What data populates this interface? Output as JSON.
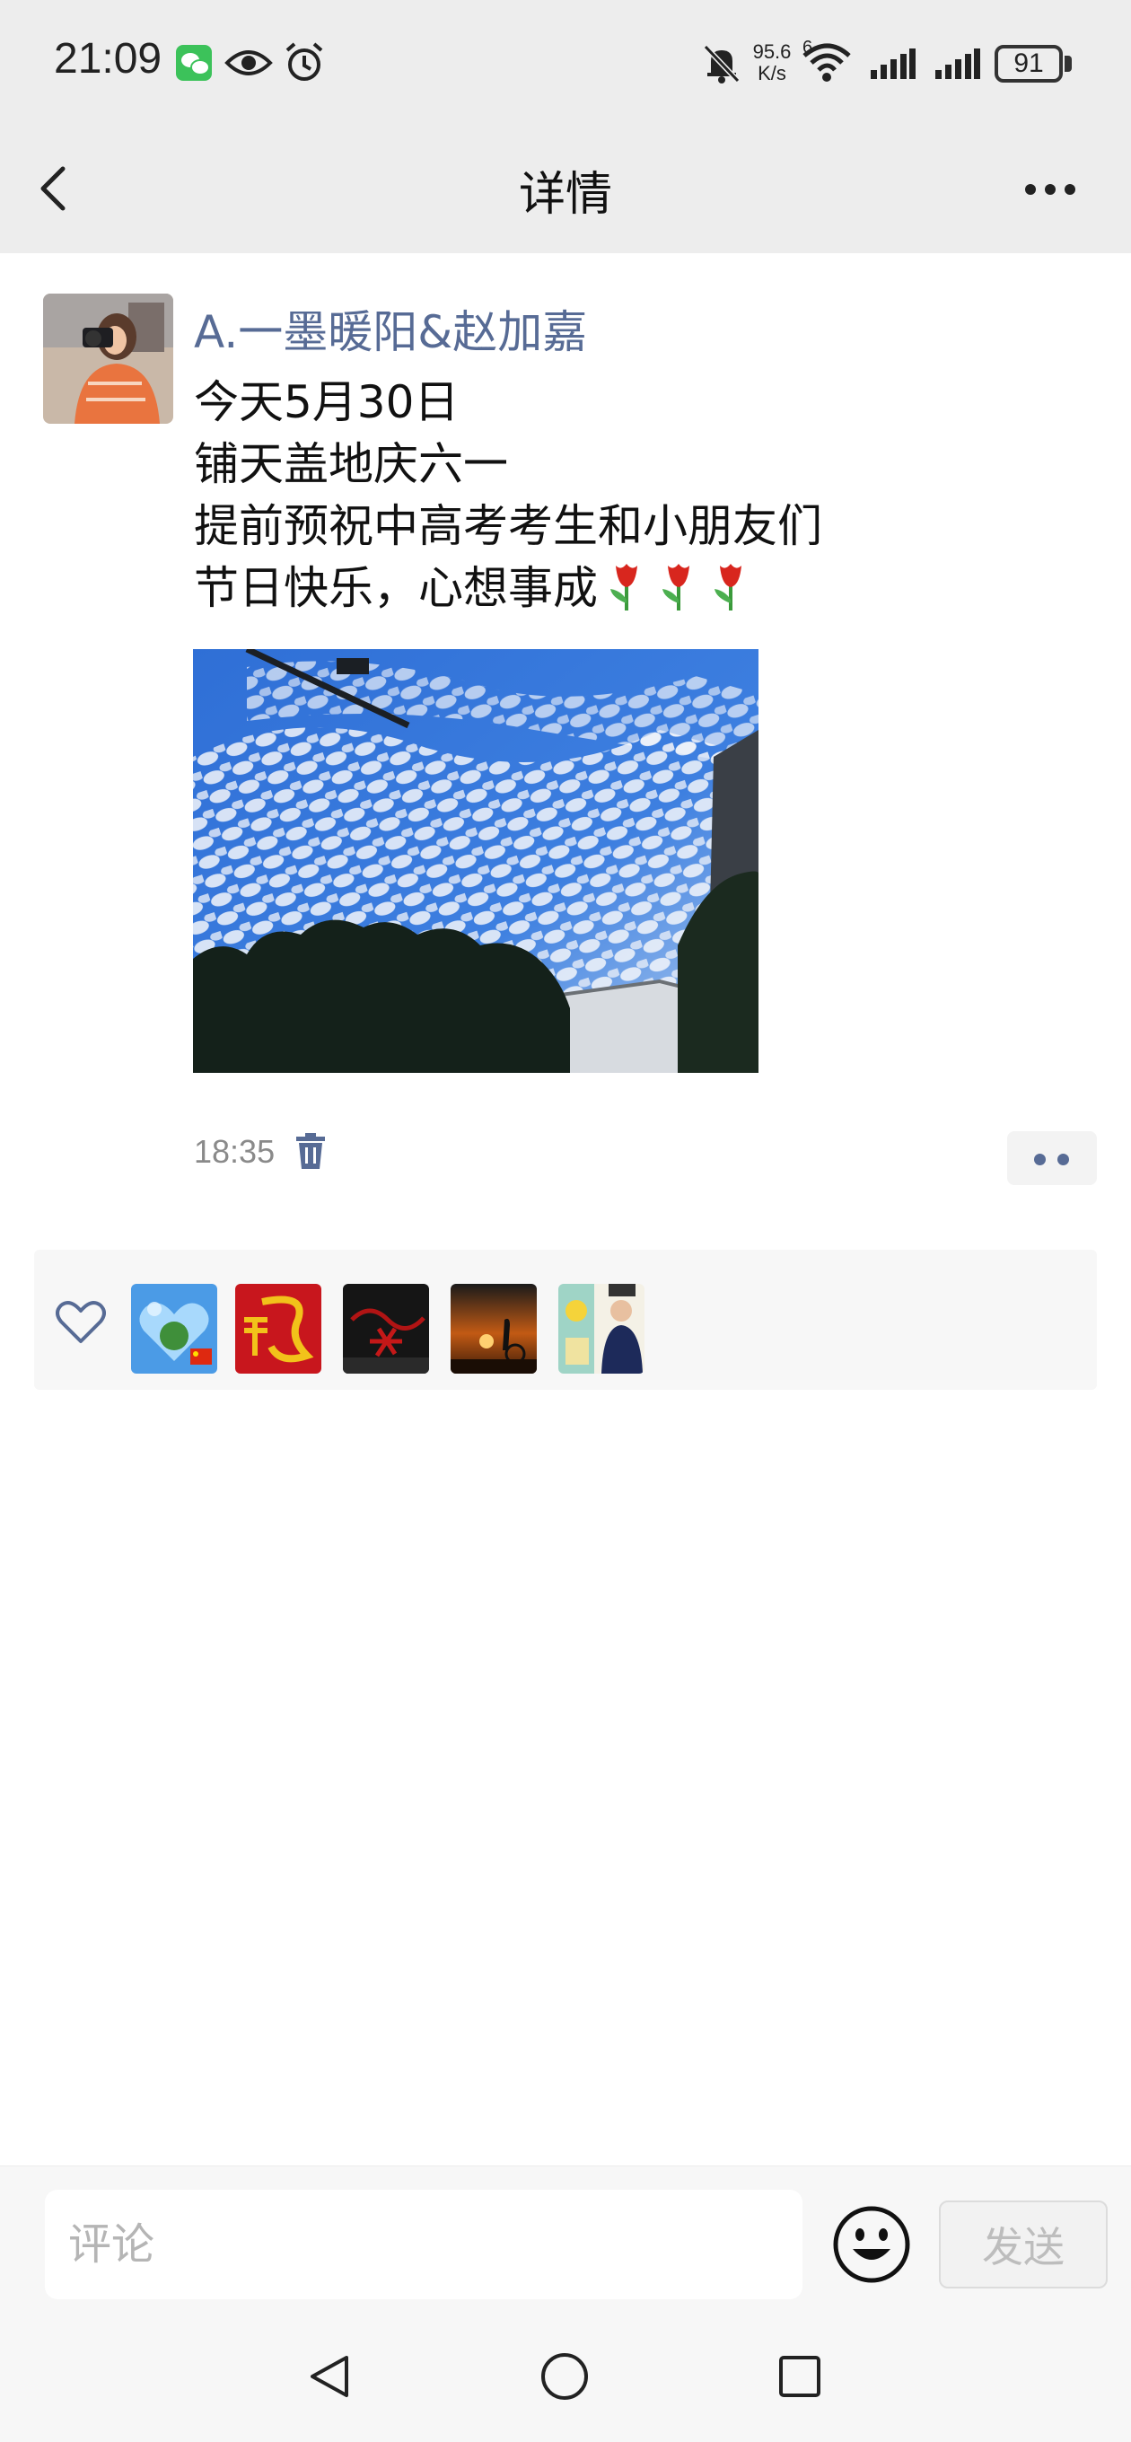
{
  "status_bar": {
    "time": "21:09",
    "net_speed_value": "95.6",
    "net_speed_unit": "K/s",
    "wifi_label": "6",
    "battery": "91",
    "icons": [
      "wechat-icon",
      "eye-icon",
      "alarm-icon",
      "mute-icon",
      "wifi-icon",
      "signal-icon",
      "signal-icon",
      "battery-icon"
    ]
  },
  "header": {
    "title": "详情",
    "icons": [
      "back-icon",
      "more-icon"
    ]
  },
  "post": {
    "author": "A.一墨暖阳&赵加嘉",
    "lines": [
      "今天5月30日",
      "铺天盖地庆六一",
      "提前预祝中高考考生和小朋友们",
      "节日快乐，心想事成"
    ],
    "emoji": [
      "tulip",
      "tulip",
      "tulip"
    ],
    "time": "18:35",
    "icons": [
      "delete-icon",
      "more-actions-icon"
    ]
  },
  "likes": {
    "icon": "heart-icon",
    "avatar_count": 5
  },
  "comment_bar": {
    "placeholder": "评论",
    "send_label": "发送",
    "icons": [
      "emoji-icon"
    ]
  },
  "nav_bar": {
    "icons": [
      "back-triangle-icon",
      "home-circle-icon",
      "recents-square-icon"
    ]
  },
  "colors": {
    "author_link": "#576b95",
    "header_bg": "#ededed",
    "likes_bg": "#f7f7f7"
  }
}
